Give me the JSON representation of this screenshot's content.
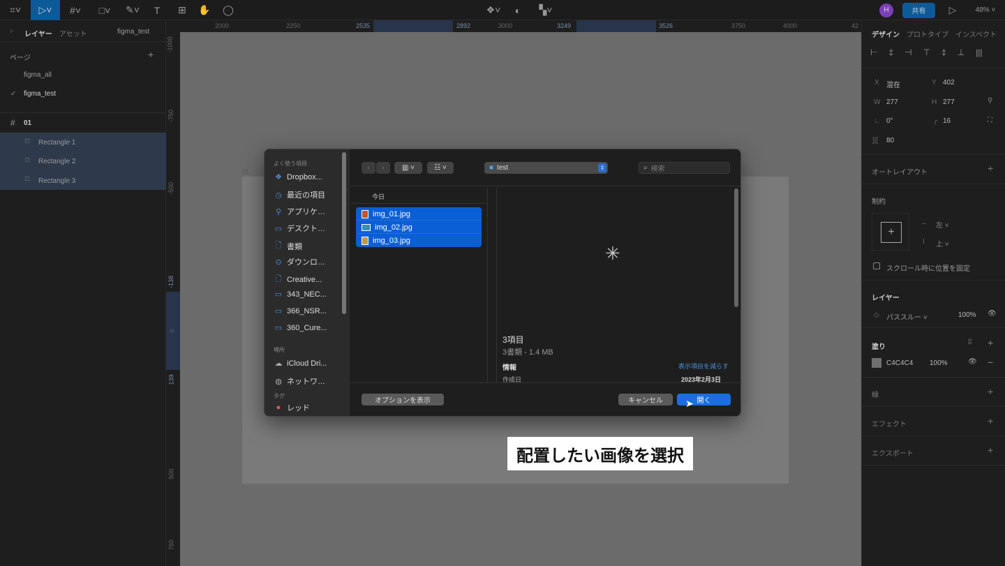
{
  "toolbar": {
    "share": "共有",
    "avatar": "H",
    "zoom": "48%"
  },
  "left": {
    "tabs": [
      "レイヤー",
      "アセット"
    ],
    "file": "figma_test",
    "pages_title": "ページ",
    "pages": [
      "figma_all",
      "figma_test"
    ],
    "frame": "01",
    "layers": [
      "Rectangle 1",
      "Rectangle 2",
      "Rectangle 3"
    ]
  },
  "hruler": [
    "2000",
    "2250",
    "2535",
    "2892",
    "3000",
    "3249",
    "3526",
    "3750",
    "4000",
    "42"
  ],
  "vruler": [
    "-1000",
    "-750",
    "-500",
    "-138",
    "0",
    "139",
    "500",
    "750"
  ],
  "canvas": {
    "frame_label": "01"
  },
  "right": {
    "tabs": [
      "デザイン",
      "プロトタイプ",
      "インスペクト"
    ],
    "x_label": "X",
    "x": "混在",
    "y_label": "Y",
    "y": "402",
    "w_label": "W",
    "w": "277",
    "h_label": "H",
    "h": "277",
    "rotation": "0°",
    "radius": "16",
    "spacing": "80",
    "autolayout": "オートレイアウト",
    "constraints": "制約",
    "c_h": "左",
    "c_v": "上",
    "fix_scroll": "スクロール時に位置を固定",
    "layer_title": "レイヤー",
    "blend": "パススルー",
    "layer_opacity": "100%",
    "fill_title": "塗り",
    "fill_hex": "C4C4C4",
    "fill_opacity": "100%",
    "fill_color": "#c4c4c4",
    "stroke": "線",
    "effect": "エフェクト",
    "export": "エクスポート"
  },
  "dialog": {
    "sidebar_fav": "よく使う項目",
    "favorites": [
      "Dropbox...",
      "最近の項目",
      "アプリケ…",
      "デスクト…",
      "書類",
      "ダウンロ…",
      "Creative...",
      "343_NEC...",
      "366_NSR...",
      "360_Cure..."
    ],
    "sidebar_loc": "場所",
    "locations": [
      "iCloud Dri...",
      "ネットワ…"
    ],
    "sidebar_tag": "タグ",
    "tags": [
      "レッド"
    ],
    "folder": "test",
    "search_placeholder": "検索",
    "column_header": "今日",
    "files": [
      "img_01.jpg",
      "img_02.jpg",
      "img_03.jpg"
    ],
    "count": "3項目",
    "summary": "3書類 - 1.4 MB",
    "info": "情報",
    "show_less": "表示項目を減らす",
    "created_label": "作成日",
    "created": "2023年2月3日",
    "options": "オプションを表示",
    "cancel": "キャンセル",
    "open": "開く"
  },
  "caption": "配置したい画像を選択"
}
